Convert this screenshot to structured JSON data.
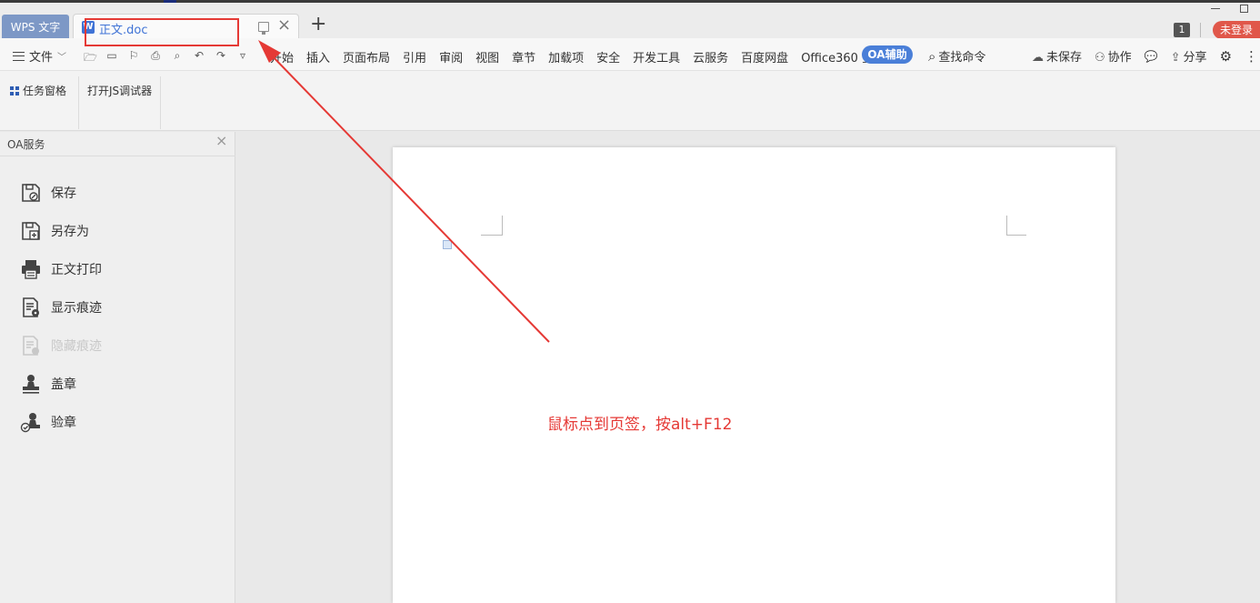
{
  "tabs": {
    "app_tab_label": "WPS 文字",
    "doc_tab_label": "正文.doc",
    "doc_icon_letter": "W",
    "add_tab": "+",
    "close_tab": "×"
  },
  "title_right": {
    "window_count": "1",
    "login_label": "未登录"
  },
  "menu": {
    "file_label": "文件",
    "items": [
      "开始",
      "插入",
      "页面布局",
      "引用",
      "审阅",
      "视图",
      "章节",
      "加载项",
      "安全",
      "开发工具",
      "云服务",
      "百度网盘",
      "Office360 签章"
    ],
    "oa_button": "OA辅助",
    "search_label": "查找命令",
    "right_items": [
      "未保存",
      "协作",
      "分享"
    ]
  },
  "ribbon": {
    "task_pane": "任务窗格",
    "js_debugger": "打开JS调试器"
  },
  "panel": {
    "title": "OA服务",
    "items": [
      {
        "label": "保存",
        "icon": "save-icon",
        "enabled": true
      },
      {
        "label": "另存为",
        "icon": "save-as-icon",
        "enabled": true
      },
      {
        "label": "正文打印",
        "icon": "printer-icon",
        "enabled": true
      },
      {
        "label": "显示痕迹",
        "icon": "show-revisions-icon",
        "enabled": true
      },
      {
        "label": "隐藏痕迹",
        "icon": "hide-revisions-icon",
        "enabled": false
      },
      {
        "label": "盖章",
        "icon": "stamp-icon",
        "enabled": true
      },
      {
        "label": "验章",
        "icon": "verify-stamp-icon",
        "enabled": true
      }
    ]
  },
  "annotation": {
    "text": "鼠标点到页签，按alt+F12",
    "color": "#e53935"
  },
  "colors": {
    "accent_blue": "#4a7fd8",
    "wps_tab": "#7d98c6",
    "login_red": "#e0574a"
  }
}
